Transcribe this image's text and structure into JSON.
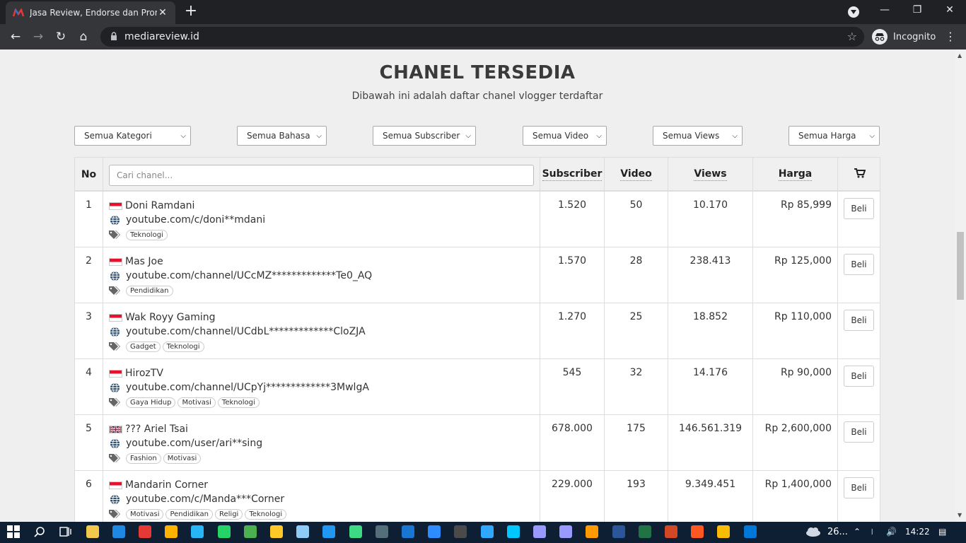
{
  "browser": {
    "tab_title": "Jasa Review, Endorse dan Promosi",
    "tab_close": "✕",
    "new_tab": "+",
    "url": "mediareview.id",
    "profile_label": "Incognito",
    "window_minimize": "—",
    "window_restore": "❐",
    "window_close": "✕",
    "back": "←",
    "forward": "→",
    "reload": "↻",
    "home": "⌂",
    "star": "☆",
    "menu": "⋮",
    "icons": [
      "mediareview-favicon",
      "lock-icon",
      "incognito-icon"
    ]
  },
  "page": {
    "heading": "CHANEL TERSEDIA",
    "subheading": "Dibawah ini adalah daftar chanel vlogger terdaftar"
  },
  "filters": [
    {
      "label": "Semua Kategori"
    },
    {
      "label": "Semua Bahasa"
    },
    {
      "label": "Semua Subscriber"
    },
    {
      "label": "Semua Video"
    },
    {
      "label": "Semua Views"
    },
    {
      "label": "Semua Harga"
    }
  ],
  "table": {
    "headers": {
      "no": "No",
      "search_placeholder": "Cari chanel...",
      "subscriber": "Subscriber",
      "video": "Video",
      "views": "Views",
      "harga": "Harga",
      "cart_icon": "cart-icon"
    },
    "buy_label": "Beli",
    "rows": [
      {
        "no": "1",
        "flag": "id",
        "name": "Doni Ramdani",
        "url": "youtube.com/c/doni**mdani",
        "tags": [
          "Teknologi"
        ],
        "subscriber": "1.520",
        "video": "50",
        "views": "10.170",
        "harga": "Rp 85,999"
      },
      {
        "no": "2",
        "flag": "id",
        "name": "Mas Joe",
        "url": "youtube.com/channel/UCcMZ*************Te0_AQ",
        "tags": [
          "Pendidikan"
        ],
        "subscriber": "1.570",
        "video": "28",
        "views": "238.413",
        "harga": "Rp 125,000"
      },
      {
        "no": "3",
        "flag": "id",
        "name": "Wak Royy Gaming",
        "url": "youtube.com/channel/UCdbL*************CloZJA",
        "tags": [
          "Gadget",
          "Teknologi"
        ],
        "subscriber": "1.270",
        "video": "25",
        "views": "18.852",
        "harga": "Rp 110,000"
      },
      {
        "no": "4",
        "flag": "id",
        "name": "HirozTV",
        "url": "youtube.com/channel/UCpYj*************3MwlgA",
        "tags": [
          "Gaya Hidup",
          "Motivasi",
          "Teknologi"
        ],
        "subscriber": "545",
        "video": "32",
        "views": "14.176",
        "harga": "Rp 90,000"
      },
      {
        "no": "5",
        "flag": "uk",
        "name": "??? Ariel Tsai",
        "url": "youtube.com/user/ari**sing",
        "tags": [
          "Fashion",
          "Motivasi"
        ],
        "subscriber": "678.000",
        "video": "175",
        "views": "146.561.319",
        "harga": "Rp 2,600,000"
      },
      {
        "no": "6",
        "flag": "id",
        "name": "Mandarin Corner",
        "url": "youtube.com/c/Manda***Corner",
        "tags": [
          "Motivasi",
          "Pendidikan",
          "Religi",
          "Teknologi"
        ],
        "subscriber": "229.000",
        "video": "193",
        "views": "9.349.451",
        "harga": "Rp 1,400,000"
      }
    ]
  },
  "taskbar": {
    "weather": "26...",
    "time": "14:22",
    "apps": [
      "windows-start",
      "search",
      "task-view",
      "file-explorer",
      "edge",
      "opera",
      "chrome-canary",
      "telegram",
      "whatsapp",
      "chrome",
      "chrome-alt",
      "notepad",
      "vscode",
      "android-studio",
      "steam",
      "teamviewer",
      "zoom",
      "obs",
      "photoshop",
      "audition",
      "premiere",
      "after-effects",
      "illustrator",
      "word",
      "excel",
      "powerpoint",
      "screen-recorder",
      "chrome-profile",
      "photos"
    ]
  }
}
